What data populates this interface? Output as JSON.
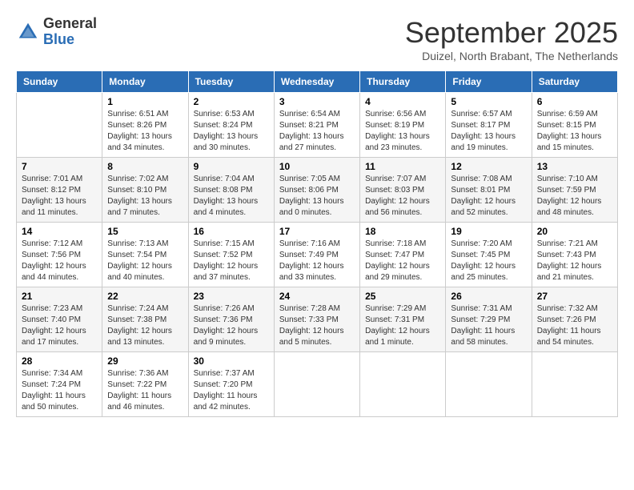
{
  "header": {
    "logo_general": "General",
    "logo_blue": "Blue",
    "title": "September 2025",
    "location": "Duizel, North Brabant, The Netherlands"
  },
  "weekdays": [
    "Sunday",
    "Monday",
    "Tuesday",
    "Wednesday",
    "Thursday",
    "Friday",
    "Saturday"
  ],
  "weeks": [
    [
      {
        "day": "",
        "info": ""
      },
      {
        "day": "1",
        "info": "Sunrise: 6:51 AM\nSunset: 8:26 PM\nDaylight: 13 hours\nand 34 minutes."
      },
      {
        "day": "2",
        "info": "Sunrise: 6:53 AM\nSunset: 8:24 PM\nDaylight: 13 hours\nand 30 minutes."
      },
      {
        "day": "3",
        "info": "Sunrise: 6:54 AM\nSunset: 8:21 PM\nDaylight: 13 hours\nand 27 minutes."
      },
      {
        "day": "4",
        "info": "Sunrise: 6:56 AM\nSunset: 8:19 PM\nDaylight: 13 hours\nand 23 minutes."
      },
      {
        "day": "5",
        "info": "Sunrise: 6:57 AM\nSunset: 8:17 PM\nDaylight: 13 hours\nand 19 minutes."
      },
      {
        "day": "6",
        "info": "Sunrise: 6:59 AM\nSunset: 8:15 PM\nDaylight: 13 hours\nand 15 minutes."
      }
    ],
    [
      {
        "day": "7",
        "info": "Sunrise: 7:01 AM\nSunset: 8:12 PM\nDaylight: 13 hours\nand 11 minutes."
      },
      {
        "day": "8",
        "info": "Sunrise: 7:02 AM\nSunset: 8:10 PM\nDaylight: 13 hours\nand 7 minutes."
      },
      {
        "day": "9",
        "info": "Sunrise: 7:04 AM\nSunset: 8:08 PM\nDaylight: 13 hours\nand 4 minutes."
      },
      {
        "day": "10",
        "info": "Sunrise: 7:05 AM\nSunset: 8:06 PM\nDaylight: 13 hours\nand 0 minutes."
      },
      {
        "day": "11",
        "info": "Sunrise: 7:07 AM\nSunset: 8:03 PM\nDaylight: 12 hours\nand 56 minutes."
      },
      {
        "day": "12",
        "info": "Sunrise: 7:08 AM\nSunset: 8:01 PM\nDaylight: 12 hours\nand 52 minutes."
      },
      {
        "day": "13",
        "info": "Sunrise: 7:10 AM\nSunset: 7:59 PM\nDaylight: 12 hours\nand 48 minutes."
      }
    ],
    [
      {
        "day": "14",
        "info": "Sunrise: 7:12 AM\nSunset: 7:56 PM\nDaylight: 12 hours\nand 44 minutes."
      },
      {
        "day": "15",
        "info": "Sunrise: 7:13 AM\nSunset: 7:54 PM\nDaylight: 12 hours\nand 40 minutes."
      },
      {
        "day": "16",
        "info": "Sunrise: 7:15 AM\nSunset: 7:52 PM\nDaylight: 12 hours\nand 37 minutes."
      },
      {
        "day": "17",
        "info": "Sunrise: 7:16 AM\nSunset: 7:49 PM\nDaylight: 12 hours\nand 33 minutes."
      },
      {
        "day": "18",
        "info": "Sunrise: 7:18 AM\nSunset: 7:47 PM\nDaylight: 12 hours\nand 29 minutes."
      },
      {
        "day": "19",
        "info": "Sunrise: 7:20 AM\nSunset: 7:45 PM\nDaylight: 12 hours\nand 25 minutes."
      },
      {
        "day": "20",
        "info": "Sunrise: 7:21 AM\nSunset: 7:43 PM\nDaylight: 12 hours\nand 21 minutes."
      }
    ],
    [
      {
        "day": "21",
        "info": "Sunrise: 7:23 AM\nSunset: 7:40 PM\nDaylight: 12 hours\nand 17 minutes."
      },
      {
        "day": "22",
        "info": "Sunrise: 7:24 AM\nSunset: 7:38 PM\nDaylight: 12 hours\nand 13 minutes."
      },
      {
        "day": "23",
        "info": "Sunrise: 7:26 AM\nSunset: 7:36 PM\nDaylight: 12 hours\nand 9 minutes."
      },
      {
        "day": "24",
        "info": "Sunrise: 7:28 AM\nSunset: 7:33 PM\nDaylight: 12 hours\nand 5 minutes."
      },
      {
        "day": "25",
        "info": "Sunrise: 7:29 AM\nSunset: 7:31 PM\nDaylight: 12 hours\nand 1 minute."
      },
      {
        "day": "26",
        "info": "Sunrise: 7:31 AM\nSunset: 7:29 PM\nDaylight: 11 hours\nand 58 minutes."
      },
      {
        "day": "27",
        "info": "Sunrise: 7:32 AM\nSunset: 7:26 PM\nDaylight: 11 hours\nand 54 minutes."
      }
    ],
    [
      {
        "day": "28",
        "info": "Sunrise: 7:34 AM\nSunset: 7:24 PM\nDaylight: 11 hours\nand 50 minutes."
      },
      {
        "day": "29",
        "info": "Sunrise: 7:36 AM\nSunset: 7:22 PM\nDaylight: 11 hours\nand 46 minutes."
      },
      {
        "day": "30",
        "info": "Sunrise: 7:37 AM\nSunset: 7:20 PM\nDaylight: 11 hours\nand 42 minutes."
      },
      {
        "day": "",
        "info": ""
      },
      {
        "day": "",
        "info": ""
      },
      {
        "day": "",
        "info": ""
      },
      {
        "day": "",
        "info": ""
      }
    ]
  ]
}
